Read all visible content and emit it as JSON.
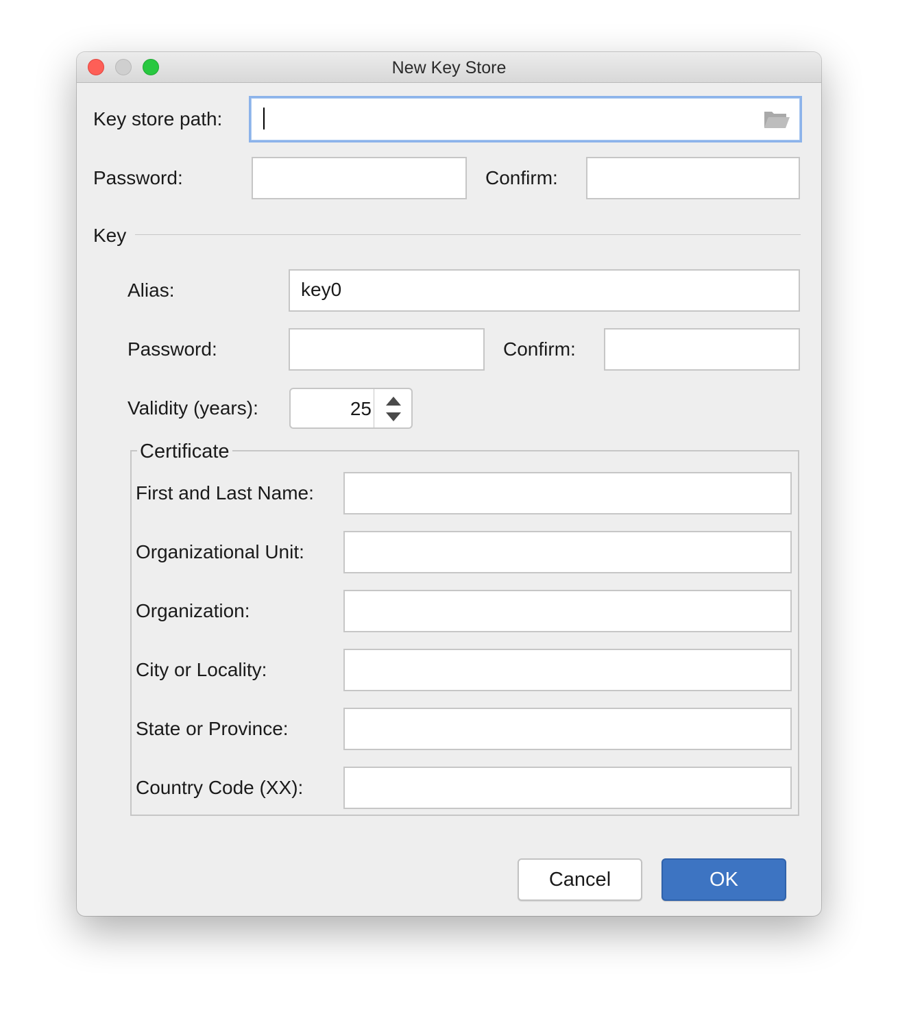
{
  "window": {
    "title": "New Key Store"
  },
  "keystore": {
    "path_label": "Key store path:",
    "path_value": "",
    "password_label": "Password:",
    "password_value": "",
    "confirm_label": "Confirm:",
    "confirm_value": ""
  },
  "key": {
    "section_label": "Key",
    "alias_label": "Alias:",
    "alias_value": "key0",
    "password_label": "Password:",
    "password_value": "",
    "confirm_label": "Confirm:",
    "confirm_value": "",
    "validity_label": "Validity (years):",
    "validity_value": "25"
  },
  "certificate": {
    "legend": "Certificate",
    "fields": [
      {
        "label": "First and Last Name:",
        "value": ""
      },
      {
        "label": "Organizational Unit:",
        "value": ""
      },
      {
        "label": "Organization:",
        "value": ""
      },
      {
        "label": "City or Locality:",
        "value": ""
      },
      {
        "label": "State or Province:",
        "value": ""
      },
      {
        "label": "Country Code (XX):",
        "value": ""
      }
    ]
  },
  "buttons": {
    "cancel_label": "Cancel",
    "ok_label": "OK"
  },
  "colors": {
    "accent": "#3d74c2",
    "focus_ring": "#8cb3ea",
    "window_bg": "#eeeeee"
  },
  "icons": {
    "browse": "folder-icon",
    "spinner_up": "arrow-up-icon",
    "spinner_down": "arrow-down-icon"
  }
}
